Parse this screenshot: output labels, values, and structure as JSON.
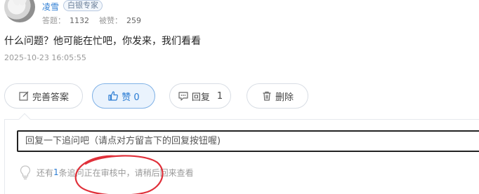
{
  "user": {
    "name": "凌雪",
    "badge": "白银专家",
    "answers_label": "答题：",
    "answers_count": "1132",
    "likes_label": "被赞：",
    "likes_count": "259"
  },
  "answer": {
    "text": "什么问题？他可能在忙吧，你发来，我们看看",
    "time": "2025-10-23 16:05:55"
  },
  "actions": {
    "edit_label": "完善答案",
    "like_label": "赞 0",
    "reply_label": "回复",
    "reply_count": "1",
    "delete_label": "删除"
  },
  "reply": {
    "placeholder": "回复一下追问吧（请点对方留言下的回复按钮喔)"
  },
  "notice": {
    "prefix": "还有",
    "count": "1",
    "suffix": "条追问正在审核中，请稍后回来查看"
  },
  "colors": {
    "accent": "#2b7cd3",
    "annotation": "#e0303a"
  }
}
